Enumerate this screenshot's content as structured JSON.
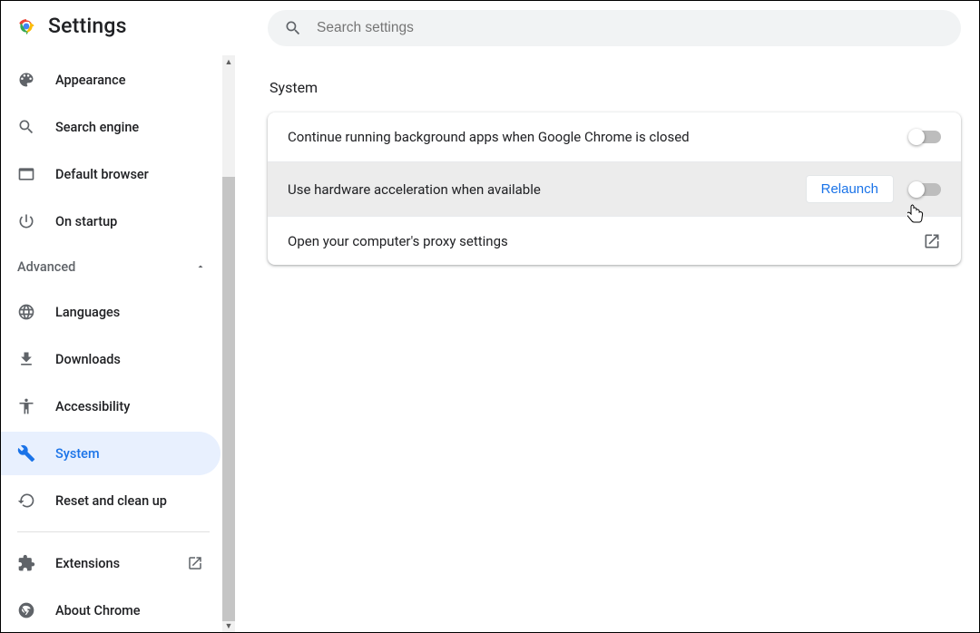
{
  "brand": {
    "title": "Settings"
  },
  "search": {
    "placeholder": "Search settings"
  },
  "sidebar": {
    "items_top": [
      {
        "id": "appearance",
        "label": "Appearance",
        "icon": "palette"
      },
      {
        "id": "search-engine",
        "label": "Search engine",
        "icon": "search"
      },
      {
        "id": "default-browser",
        "label": "Default browser",
        "icon": "browser"
      },
      {
        "id": "on-startup",
        "label": "On startup",
        "icon": "power"
      }
    ],
    "advanced_label": "Advanced",
    "items_advanced": [
      {
        "id": "languages",
        "label": "Languages",
        "icon": "globe"
      },
      {
        "id": "downloads",
        "label": "Downloads",
        "icon": "download"
      },
      {
        "id": "accessibility",
        "label": "Accessibility",
        "icon": "accessibility"
      },
      {
        "id": "system",
        "label": "System",
        "icon": "wrench",
        "selected": true
      },
      {
        "id": "reset",
        "label": "Reset and clean up",
        "icon": "restore"
      }
    ],
    "items_bottom": [
      {
        "id": "extensions",
        "label": "Extensions",
        "icon": "extension",
        "external": true
      },
      {
        "id": "about",
        "label": "About Chrome",
        "icon": "chrome-gray"
      }
    ]
  },
  "page": {
    "title": "System",
    "rows": [
      {
        "id": "bg-apps",
        "label": "Continue running background apps when Google Chrome is closed",
        "toggle": false
      },
      {
        "id": "hw-accel",
        "label": "Use hardware acceleration when available",
        "toggle": false,
        "relaunch": "Relaunch",
        "highlight": true
      },
      {
        "id": "proxy",
        "label": "Open your computer's proxy settings",
        "external": true
      }
    ]
  }
}
